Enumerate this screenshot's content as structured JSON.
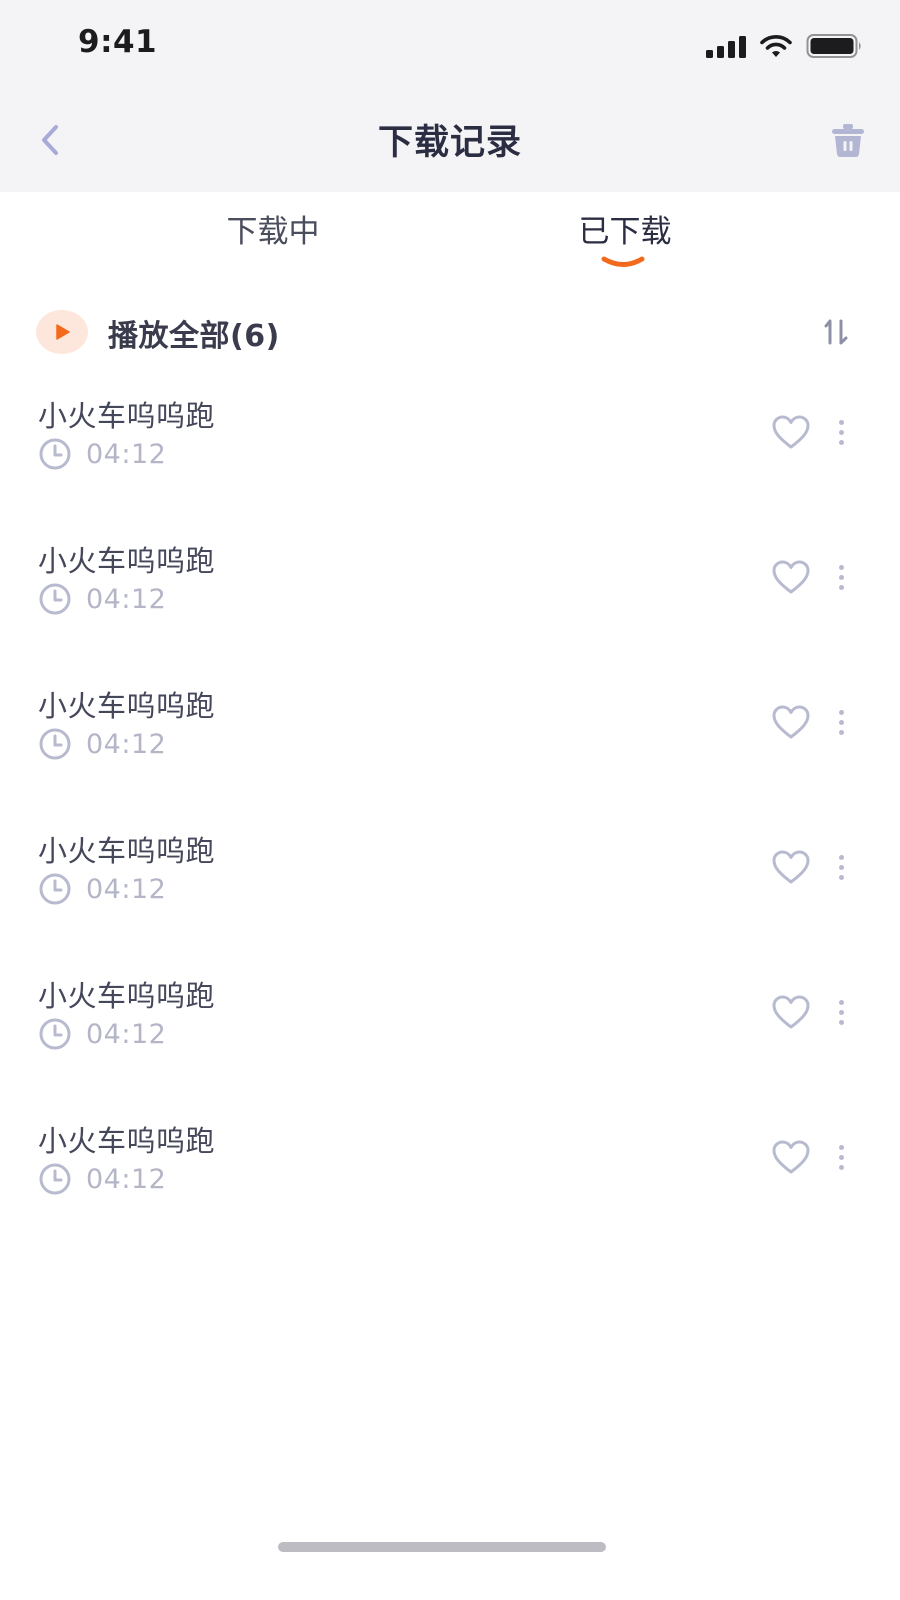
{
  "status_bar": {
    "time": "9:41"
  },
  "nav": {
    "title": "下载记录"
  },
  "tabs": [
    {
      "label": "下载中",
      "active": false
    },
    {
      "label": "已下载",
      "active": true
    }
  ],
  "play_all": {
    "label": "播放全部(6)"
  },
  "tracks": [
    {
      "title": "小火车呜呜跑",
      "duration": "04:12"
    },
    {
      "title": "小火车呜呜跑",
      "duration": "04:12"
    },
    {
      "title": "小火车呜呜跑",
      "duration": "04:12"
    },
    {
      "title": "小火车呜呜跑",
      "duration": "04:12"
    },
    {
      "title": "小火车呜呜跑",
      "duration": "04:12"
    },
    {
      "title": "小火车呜呜跑",
      "duration": "04:12"
    }
  ],
  "icons": {
    "back": "chevron-left-icon",
    "trash": "trash-icon",
    "play": "play-icon",
    "sort": "sort-icon",
    "clock": "clock-icon",
    "heart": "heart-icon",
    "more": "more-vertical-icon"
  },
  "colors": {
    "accent": "#f36a1d",
    "header_bg": "#f4f4f6",
    "icon_muted": "#b8bbd0",
    "title_text": "#2b2d42"
  }
}
